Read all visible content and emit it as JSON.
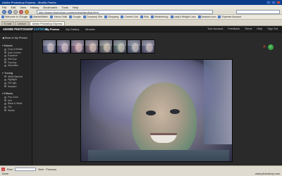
{
  "browser": {
    "title": "Adobe Photoshop Express - Mozilla Firefox",
    "menu": [
      "File",
      "Edit",
      "View",
      "History",
      "Bookmarks",
      "Tools",
      "Help"
    ],
    "url": "http://www.photoshop.com/express/landing.html",
    "bookmarks": [
      "Welcome to iGoogle",
      "MarketWatch",
      "Yahoo! Mail",
      "Google",
      "Company Site",
      "Shopping",
      "Current Link",
      "Kids",
      "Weatherbug",
      "Lady's Weight Loss",
      "Amazon.com",
      "Expense Account"
    ],
    "tabs": [
      "E-mail",
      "Lesson",
      "Adobe Photoshop Express"
    ],
    "status_text": "Done",
    "status_right": "www.photoshop.com",
    "find_label": "Find:",
    "find_next": "Next",
    "find_previous": "Previous"
  },
  "app": {
    "logo": "ADOBE PHOTOSHOP",
    "logo_suffix": "EXPRESS",
    "nav": [
      "My Photos",
      "My Gallery",
      "Browse"
    ],
    "user_nav": [
      "Your Account",
      "Feedback",
      "Terms",
      "Help",
      "Sign Out"
    ]
  },
  "sidebar": {
    "back_label": "Back to My Photos",
    "sections": [
      {
        "title": "Basics",
        "items": [
          "Crop & Rotate",
          "Auto Correct",
          "Exposure",
          "Red-Eye",
          "Touchup",
          "Saturation"
        ]
      },
      {
        "title": "Tuning",
        "items": [
          "White Balance",
          "Highlight",
          "Fill Light",
          "Sharpen"
        ]
      },
      {
        "title": "Effects",
        "items": [
          "Pop Color",
          "Hue",
          "Black & White",
          "Tint",
          "Sketch"
        ]
      }
    ]
  },
  "variations": {
    "count": 8,
    "tints": [
      "#8a94b8",
      "#9b8cb7",
      "#b68aa0",
      "#a88d8a",
      "#9aa08a",
      "#7fa08e",
      "#7f95a8",
      "#8a8ea8"
    ]
  },
  "icons": {
    "cancel": "cancel-x-icon",
    "apply": "apply-check-icon"
  },
  "colors": {
    "accent": "#3fa7e0",
    "apply": "#3aa646",
    "cancel": "#e04a3a"
  }
}
